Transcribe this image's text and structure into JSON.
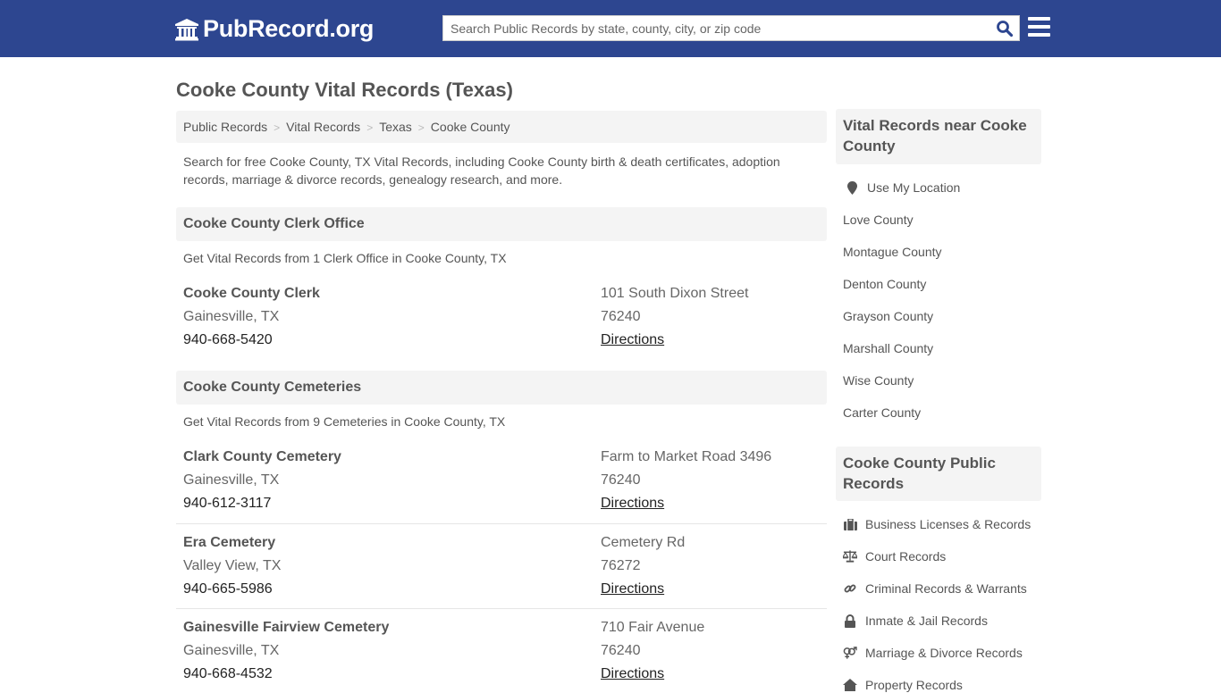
{
  "header": {
    "logo_text": "PubRecord.org",
    "search_placeholder": "Search Public Records by state, county, city, or zip code",
    "brand_color": "#2d4690"
  },
  "page_title": "Cooke County Vital Records (Texas)",
  "breadcrumb": [
    "Public Records",
    "Vital Records",
    "Texas",
    "Cooke County"
  ],
  "intro": "Search for free Cooke County, TX Vital Records, including Cooke County birth & death certificates, adoption records, marriage & divorce records, genealogy research, and more.",
  "sections": [
    {
      "title": "Cooke County Clerk Office",
      "subtitle": "Get Vital Records from 1 Clerk Office in Cooke County, TX",
      "entries": [
        {
          "name": "Cooke County Clerk",
          "city": "Gainesville, TX",
          "phone": "940-668-5420",
          "address": "101 South Dixon Street",
          "zip": "76240",
          "directions": "Directions"
        }
      ]
    },
    {
      "title": "Cooke County Cemeteries",
      "subtitle": "Get Vital Records from 9 Cemeteries in Cooke County, TX",
      "entries": [
        {
          "name": "Clark County Cemetery",
          "city": "Gainesville, TX",
          "phone": "940-612-3117",
          "address": "Farm to Market Road 3496",
          "zip": "76240",
          "directions": "Directions"
        },
        {
          "name": "Era Cemetery",
          "city": "Valley View, TX",
          "phone": "940-665-5986",
          "address": "Cemetery Rd",
          "zip": "76272",
          "directions": "Directions"
        },
        {
          "name": "Gainesville Fairview Cemetery",
          "city": "Gainesville, TX",
          "phone": "940-668-4532",
          "address": "710 Fair Avenue",
          "zip": "76240",
          "directions": "Directions"
        }
      ]
    }
  ],
  "sidebar": {
    "nearby": {
      "title": "Vital Records near Cooke County",
      "use_location": "Use My Location",
      "items": [
        "Love County",
        "Montague County",
        "Denton County",
        "Grayson County",
        "Marshall County",
        "Wise County",
        "Carter County"
      ]
    },
    "public_records": {
      "title": "Cooke County Public Records",
      "items": [
        {
          "label": "Business Licenses & Records",
          "icon": "briefcase-icon"
        },
        {
          "label": "Court Records",
          "icon": "balance-scale-icon"
        },
        {
          "label": "Criminal Records & Warrants",
          "icon": "link-icon"
        },
        {
          "label": "Inmate & Jail Records",
          "icon": "lock-icon"
        },
        {
          "label": "Marriage & Divorce Records",
          "icon": "venus-mars-icon"
        },
        {
          "label": "Property Records",
          "icon": "home-icon"
        }
      ]
    }
  }
}
